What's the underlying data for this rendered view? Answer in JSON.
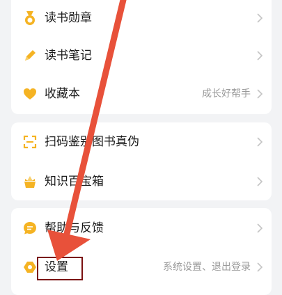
{
  "groups": [
    {
      "items": [
        {
          "label": "读书勋章",
          "right": "",
          "icon": "medal-icon"
        },
        {
          "label": "读书笔记",
          "right": "",
          "icon": "pencil-icon"
        },
        {
          "label": "收藏本",
          "right": "成长好帮手",
          "icon": "heart-icon"
        }
      ]
    },
    {
      "items": [
        {
          "label": "扫码鉴别图书真伪",
          "right": "",
          "icon": "scan-icon"
        },
        {
          "label": "知识百宝箱",
          "right": "",
          "icon": "treasure-box-icon"
        }
      ]
    },
    {
      "items": [
        {
          "label": "帮助与反馈",
          "right": "",
          "icon": "chat-bubble-icon"
        },
        {
          "label": "设置",
          "right": "系统设置、退出登录",
          "icon": "settings-icon"
        }
      ]
    }
  ],
  "colors": {
    "accent_orange": "#f5b323",
    "annotation_arrow": "#e8513a",
    "annotation_box": "#7a1010"
  }
}
